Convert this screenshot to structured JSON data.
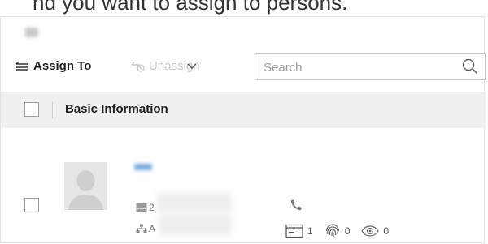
{
  "top_strip": {
    "text": "nd you want to assign to persons."
  },
  "toolbar": {
    "assign_label": "Assign To",
    "unassign_label": "Unassign",
    "search_placeholder": "Search"
  },
  "table": {
    "header_label": "Basic Information",
    "rows": [
      {
        "id_prefix": "2",
        "org_prefix": "A",
        "card_count": "1",
        "fingerprint_count": "0",
        "iris_count": "0"
      }
    ]
  }
}
